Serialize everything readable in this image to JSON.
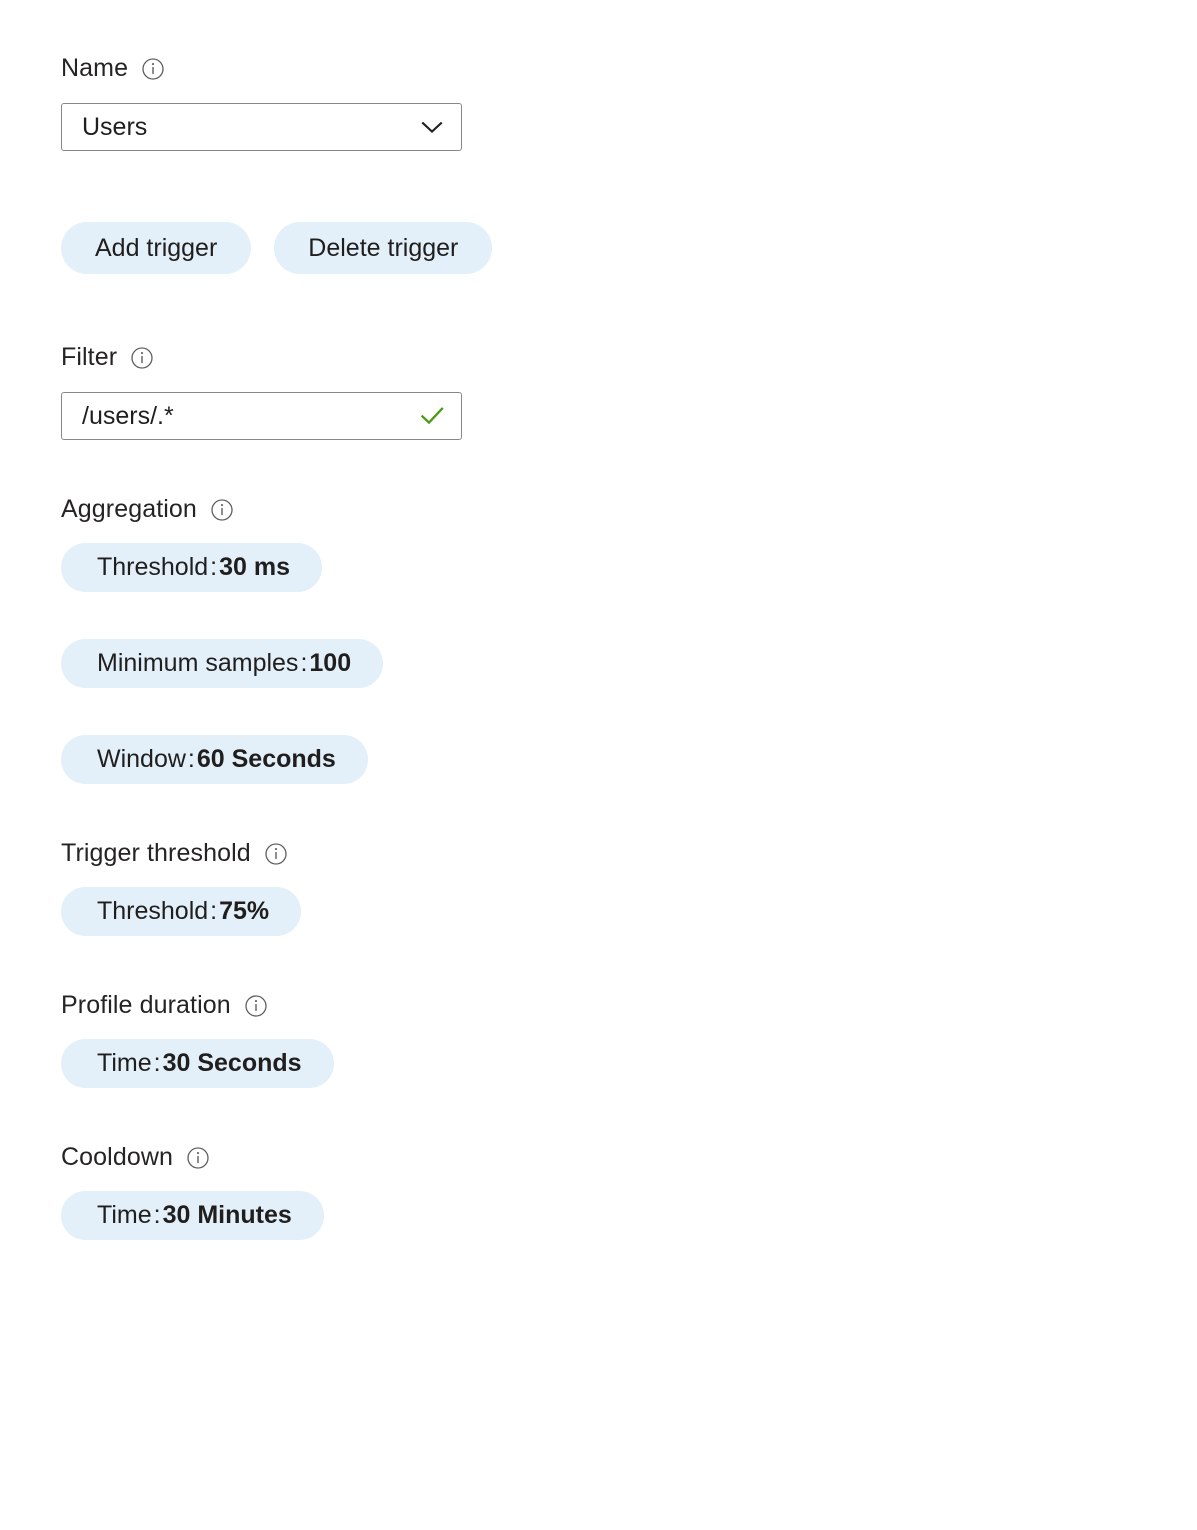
{
  "colors": {
    "pill_background": "#e3eff9",
    "text": "#201f1e",
    "border": "#8a8886",
    "valid_check": "#4f9a18",
    "info_icon": "#605e5c"
  },
  "form": {
    "name_field": {
      "label": "Name",
      "info_icon": "info-circle-icon",
      "dropdown": {
        "value": "Users",
        "chevron_icon": "chevron-down-icon"
      }
    },
    "actions": [
      {
        "label": "Add trigger",
        "name": "add-trigger-button"
      },
      {
        "label": "Delete trigger",
        "name": "delete-trigger-button"
      }
    ],
    "filter_field": {
      "label": "Filter",
      "info_icon": "info-circle-icon",
      "input": {
        "value": "/users/.*",
        "placeholder": "",
        "validation_icon": "checkmark-icon"
      }
    },
    "aggregation": {
      "label": "Aggregation",
      "info_icon": "info-circle-icon",
      "pills": [
        {
          "key": "Threshold",
          "separator": ":",
          "value": "30 ms",
          "name": "aggregation-threshold-pill"
        },
        {
          "key": "Minimum samples",
          "separator": ":",
          "value": "100",
          "name": "aggregation-minimum-samples-pill"
        },
        {
          "key": "Window",
          "separator": ":",
          "value": "60 Seconds",
          "name": "aggregation-window-pill"
        }
      ]
    },
    "trigger_threshold": {
      "label": "Trigger threshold",
      "info_icon": "info-circle-icon",
      "pills": [
        {
          "key": "Threshold",
          "separator": ":",
          "value": "75%",
          "name": "trigger-threshold-pill"
        }
      ]
    },
    "profile_duration": {
      "label": "Profile duration",
      "info_icon": "info-circle-icon",
      "pills": [
        {
          "key": "Time",
          "separator": ":",
          "value": "30 Seconds",
          "name": "profile-duration-time-pill"
        }
      ]
    },
    "cooldown": {
      "label": "Cooldown",
      "info_icon": "info-circle-icon",
      "pills": [
        {
          "key": "Time",
          "separator": ":",
          "value": "30 Minutes",
          "name": "cooldown-time-pill"
        }
      ]
    }
  }
}
